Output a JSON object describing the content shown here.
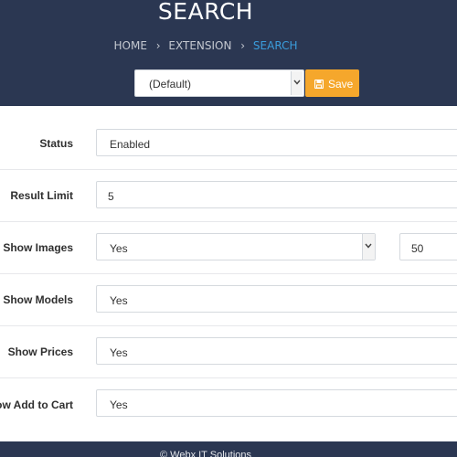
{
  "header": {
    "title": "SEARCH",
    "breadcrumb": [
      "HOME",
      "EXTENSION",
      "SEARCH"
    ],
    "breadcrumb_separator": "›",
    "store_select": {
      "value": "(Default)"
    },
    "save_label": "Save"
  },
  "form": {
    "rows": [
      {
        "label": "Status",
        "value": "Enabled"
      },
      {
        "label": "Result Limit",
        "value": "5"
      },
      {
        "label": "Show Images",
        "value": "Yes",
        "extra_value": "50"
      },
      {
        "label": "Show Models",
        "value": "Yes"
      },
      {
        "label": "Show Prices",
        "value": "Yes"
      },
      {
        "label": "Show Add to Cart",
        "value": "Yes"
      }
    ]
  },
  "footer": {
    "text": "© Webx IT Solutions"
  },
  "colors": {
    "header_bg": "#2b3752",
    "accent": "#f5a72c",
    "link_active": "#3a9ddc"
  }
}
